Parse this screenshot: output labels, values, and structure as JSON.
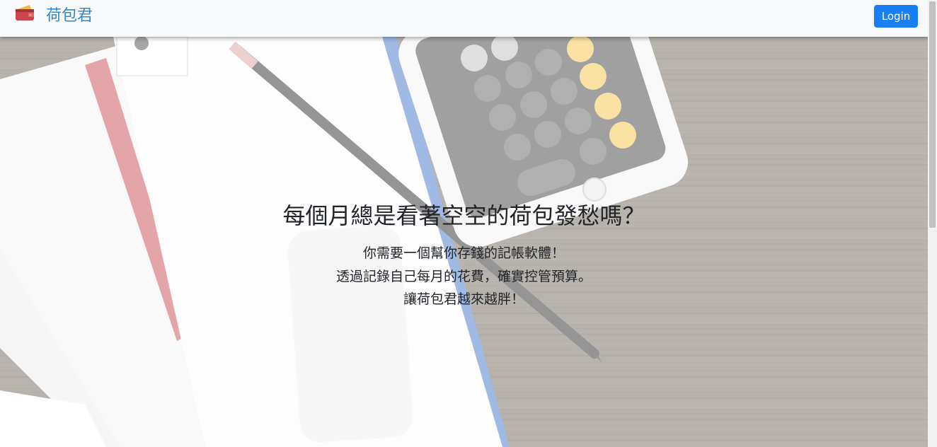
{
  "navbar": {
    "brand_label": "荷包君",
    "login_label": "Login"
  },
  "hero": {
    "headline": "每個月總是看著空空的荷包發愁嗎？",
    "lines": [
      "你需要一個幫你存錢的記帳軟體！",
      "透過記錄自己每月的花費，確實控管預算。",
      "讓荷包君越來越胖！"
    ]
  },
  "colors": {
    "brand": "#2e86d4",
    "button": "#1a7ff5",
    "navbar_bg": "#f8f9fa"
  },
  "icons": {
    "brand_icon": "wallet-icon"
  }
}
